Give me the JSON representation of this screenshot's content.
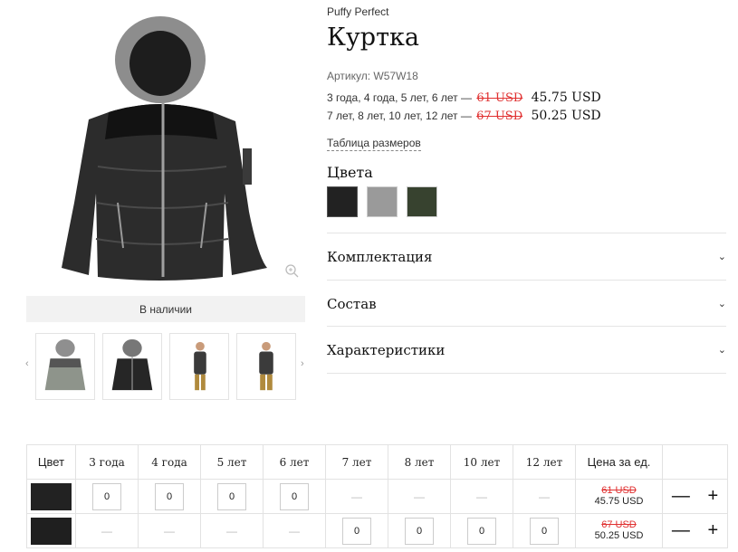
{
  "product": {
    "brand": "Puffy Perfect",
    "title": "Куртка",
    "sku": "Артикул: W57W18",
    "prices": [
      {
        "sizes": "3 года, 4 года, 5 лет, 6 лет —",
        "old": "61 USD",
        "new": "45.75 USD"
      },
      {
        "sizes": "7 лет, 8 лет, 10 лет, 12 лет —",
        "old": "67 USD",
        "new": "50.25 USD"
      }
    ],
    "size_table_link": "Таблица размеров",
    "colors_title": "Цвета",
    "colors": [
      "#222222",
      "#9a9a9a",
      "#37422f"
    ],
    "stock_status": "В наличии"
  },
  "gallery": {
    "arrow_left": "‹",
    "arrow_right": "›",
    "zoom_icon": "zoom-in-icon"
  },
  "accordion": [
    {
      "label": "Комплектация",
      "icon": "⌄"
    },
    {
      "label": "Состав",
      "icon": "⌄"
    },
    {
      "label": "Характеристики",
      "icon": "⌄"
    }
  ],
  "grid": {
    "headers": [
      "Цвет",
      "3 года",
      "4 года",
      "5 лет",
      "6 лет",
      "7 лет",
      "8 лет",
      "10 лет",
      "12 лет",
      "Цена за ед.",
      ""
    ],
    "rows": [
      {
        "color": "#222222",
        "cells": [
          "0",
          "0",
          "0",
          "0",
          "—",
          "—",
          "—",
          "—"
        ],
        "old": "61 USD",
        "new": "45.75 USD",
        "minus": "—",
        "plus": "+"
      },
      {
        "color": "#1f1f1f",
        "cells": [
          "—",
          "—",
          "—",
          "—",
          "0",
          "0",
          "0",
          "0"
        ],
        "old": "67 USD",
        "new": "50.25 USD",
        "minus": "—",
        "plus": "+"
      }
    ]
  }
}
